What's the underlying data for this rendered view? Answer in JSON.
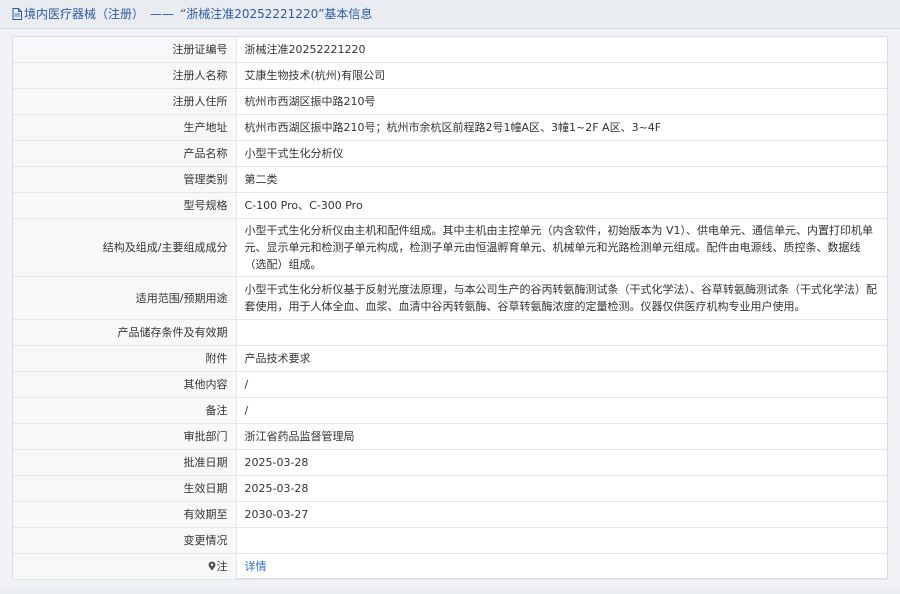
{
  "header": {
    "category": "境内医疗器械（注册）",
    "separator": "——",
    "title": "“浙械注准20252221220”基本信息"
  },
  "rows": [
    {
      "label": "注册证编号",
      "value": "浙械注准20252221220"
    },
    {
      "label": "注册人名称",
      "value": "艾康生物技术(杭州)有限公司"
    },
    {
      "label": "注册人住所",
      "value": "杭州市西湖区振中路210号"
    },
    {
      "label": "生产地址",
      "value": "杭州市西湖区振中路210号；杭州市余杭区前程路2号1幢A区、3幢1~2F A区、3~4F"
    },
    {
      "label": "产品名称",
      "value": "小型干式生化分析仪"
    },
    {
      "label": "管理类别",
      "value": "第二类"
    },
    {
      "label": "型号规格",
      "value": "C-100 Pro、C-300 Pro"
    },
    {
      "label": "结构及组成/主要组成成分",
      "value": "小型干式生化分析仪由主机和配件组成。其中主机由主控单元（内含软件，初始版本为 V1）、供电单元、通信单元、内置打印机单元、显示单元和检测子单元构成，检测子单元由恒温孵育单元、机械单元和光路检测单元组成。配件由电源线、质控条、数据线（选配）组成。"
    },
    {
      "label": "适用范围/预期用途",
      "value": "小型干式生化分析仪基于反射光度法原理，与本公司生产的谷丙转氨酶测试条（干式化学法）、谷草转氨酶测试条（干式化学法）配套使用，用于人体全血、血浆、血清中谷丙转氨酶、谷草转氨酶浓度的定量检测。仪器仅供医疗机构专业用户使用。"
    },
    {
      "label": "产品储存条件及有效期",
      "value": ""
    },
    {
      "label": "附件",
      "value": "产品技术要求"
    },
    {
      "label": "其他内容",
      "value": "/"
    },
    {
      "label": "备注",
      "value": "/"
    },
    {
      "label": "审批部门",
      "value": "浙江省药品监督管理局"
    },
    {
      "label": "批准日期",
      "value": "2025-03-28"
    },
    {
      "label": "生效日期",
      "value": "2025-03-28"
    },
    {
      "label": "有效期至",
      "value": "2030-03-27"
    },
    {
      "label": "变更情况",
      "value": ""
    },
    {
      "label": "注",
      "value": "详情"
    }
  ],
  "icons": {
    "header_icon": "document-icon",
    "note_icon": "pin-icon"
  },
  "colors": {
    "header_text": "#2c5aa0",
    "link": "#2f6fd0",
    "label_bg": "#f7f8fa"
  }
}
